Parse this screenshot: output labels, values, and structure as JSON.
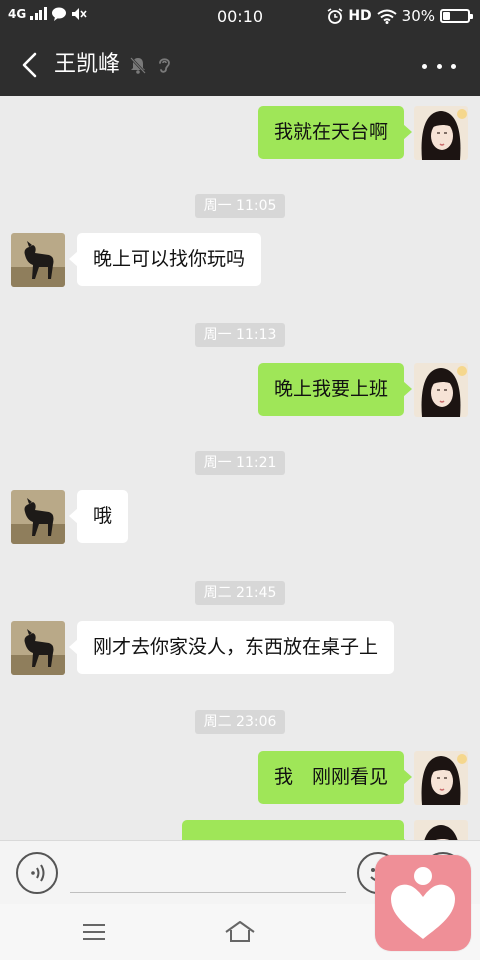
{
  "status_bar": {
    "network": "4G",
    "time": "00:10",
    "hd": "HD",
    "battery_text": "30%",
    "battery_level": 0.3
  },
  "header": {
    "contact_name": "王凯峰",
    "icons": [
      "back-arrow-icon",
      "mute-bell-icon",
      "earpiece-icon",
      "more-dots-icon"
    ]
  },
  "messages": [
    {
      "type": "out",
      "text": "我就在天台啊"
    },
    {
      "type": "time",
      "text": "周一 11:05"
    },
    {
      "type": "in",
      "text": "晚上可以找你玩吗"
    },
    {
      "type": "time",
      "text": "周一 11:13"
    },
    {
      "type": "out",
      "text": "晚上我要上班"
    },
    {
      "type": "time",
      "text": "周一 11:21"
    },
    {
      "type": "in",
      "text": "哦"
    },
    {
      "type": "time",
      "text": "周二 21:45"
    },
    {
      "type": "in",
      "text": "刚才去你家没人，东西放在桌子上"
    },
    {
      "type": "time",
      "text": "周二 23:06"
    },
    {
      "type": "out",
      "text": "我　刚刚看见"
    },
    {
      "type": "out",
      "text": ""
    }
  ],
  "input_bar": {
    "placeholder": "",
    "icons": [
      "voice-icon",
      "emoji-icon",
      "plus-icon"
    ]
  },
  "colors": {
    "header_bg": "#2e2e2e",
    "chat_bg": "#ebebeb",
    "out_bubble": "#9fe658",
    "in_bubble": "#ffffff",
    "timestamp_bg": "#d7d7d7",
    "badge_bg": "#ef8f97"
  }
}
